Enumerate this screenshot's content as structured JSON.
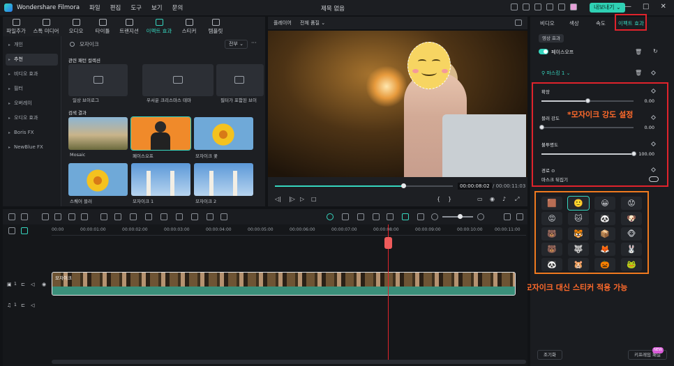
{
  "app": {
    "name": "Wondershare Filmora",
    "menu": [
      "파일",
      "편집",
      "도구",
      "보기",
      "문의"
    ],
    "document_title": "제목 없음",
    "export_label": "내보내기",
    "window_controls": [
      "—",
      "□",
      "✕"
    ]
  },
  "library_tabs": [
    {
      "label": "파일추가",
      "icon": "import-icon"
    },
    {
      "label": "스톡 미디어",
      "icon": "stock-media-icon"
    },
    {
      "label": "오디오",
      "icon": "audio-icon"
    },
    {
      "label": "타이틀",
      "icon": "title-icon"
    },
    {
      "label": "트랜지션",
      "icon": "transition-icon"
    },
    {
      "label": "이펙트 효과",
      "icon": "effects-icon",
      "active": true
    },
    {
      "label": "스티커",
      "icon": "sticker-icon"
    },
    {
      "label": "템플릿",
      "icon": "template-icon"
    }
  ],
  "sidebar": {
    "items": [
      "개인",
      "추천",
      "비디오 효과",
      "필터",
      "오버레이",
      "오디오 효과",
      "Boris FX",
      "NewBlue FX"
    ],
    "active_index": 1
  },
  "search": {
    "placeholder": "모자이크",
    "filter_label": "전부",
    "more": "···"
  },
  "related": {
    "title": "관련 패턴 컬렉션",
    "cards": [
      "일상 브이로그",
      "우서운 크리스마스 테마",
      "필터가 포함된 브이"
    ]
  },
  "results": {
    "title": "검색 결과",
    "items": [
      "Mosaic",
      "페이스오프",
      "모자이크 꽃",
      "스퀘어 블러",
      "모자이크 1",
      "모자이크 2"
    ]
  },
  "preview": {
    "label": "플레이어",
    "quality": "전체 품질",
    "progress": 0.72,
    "time_current": "00:00:08:02",
    "time_total": "/ 00:00:11:03"
  },
  "right_panel": {
    "tabs": [
      "비디오",
      "색상",
      "속도",
      "이펙트 효과"
    ],
    "active_tab": "이펙트 효과",
    "chip": "영상 효과",
    "effect_name": "페이스오프",
    "mask_label": "마스킹 1",
    "sliders": [
      {
        "label": "확장",
        "value": "0.00",
        "level": 0.5
      },
      {
        "label": "블러 강도",
        "value": "0.00",
        "level": 0.0
      },
      {
        "label": "불투명도",
        "value": "100.00",
        "level": 1.0
      }
    ],
    "path_label": "경로 ⊙",
    "invert_label": "마스크 뒤집기",
    "annotation_strength": "*모자이크 강도 설정",
    "reset_button": "조기화",
    "keyframe_button": "키프레임 패널",
    "keyframe_badge": "NEW"
  },
  "stickers": [
    "🟫",
    "🙂",
    "😀",
    "😟",
    "😡",
    "🐱",
    "🐼",
    "🐶",
    "🐻",
    "🐯",
    "📦",
    "🐵",
    "🐻",
    "🐺",
    "🦊",
    "🐰",
    "🐼",
    "🐹",
    "🎃",
    "🐸"
  ],
  "annotation_sticker": "▲모자이크 대신 스티커 적용 가능",
  "timeline": {
    "ruler": [
      "00:00",
      "00:00:01:00",
      "00:00:02:00",
      "00:00:03:00",
      "00:00:04:00",
      "00:00:05:00",
      "00:00:06:00",
      "00:00:07:00",
      "00:00:08:00",
      "00:00:09:00",
      "00:00:10:00",
      "00:00:11:00"
    ],
    "clip_title": "모자이크",
    "video_track": "1",
    "audio_track": "1"
  }
}
